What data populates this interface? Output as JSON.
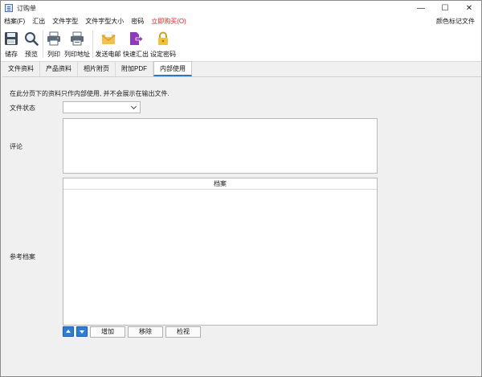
{
  "window": {
    "title": "订购单",
    "controls": {
      "minimize": "—",
      "maximize": "☐",
      "close": "✕"
    }
  },
  "menu": {
    "items": [
      "档案(F)",
      "汇出",
      "文件字型",
      "文件字型大小",
      "密码"
    ],
    "buy_label": "立即购买(O)",
    "buy_color": "#e02020",
    "right_label": "颜色标记文件"
  },
  "toolbar": {
    "tools": [
      {
        "label": "储存",
        "icon": "floppy-disk-icon"
      },
      {
        "label": "预览",
        "icon": "magnifier-icon"
      },
      {
        "label": "列印",
        "icon": "printer-icon"
      },
      {
        "label": "列印地址",
        "icon": "printer-address-icon"
      },
      {
        "label": "发送电邮",
        "icon": "envelope-icon"
      },
      {
        "label": "快速汇出",
        "icon": "export-file-icon"
      },
      {
        "label": "设定密码",
        "icon": "padlock-icon"
      }
    ]
  },
  "tabs": {
    "items": [
      "文件资料",
      "产品资料",
      "相片附页",
      "附加PDF",
      "内部使用"
    ],
    "active_index": 4,
    "active_color": "#2f74c9"
  },
  "internal": {
    "note": "在此分页下的资料只作内部使用, 并不会展示在输出文件.",
    "status_label": "文件状态",
    "status_value": "",
    "comment_label": "评论",
    "comment_value": "",
    "ref_label": "参考档案",
    "files_header": "档案",
    "files": [],
    "buttons": {
      "add": "增加",
      "remove": "移除",
      "view": "检视"
    }
  }
}
